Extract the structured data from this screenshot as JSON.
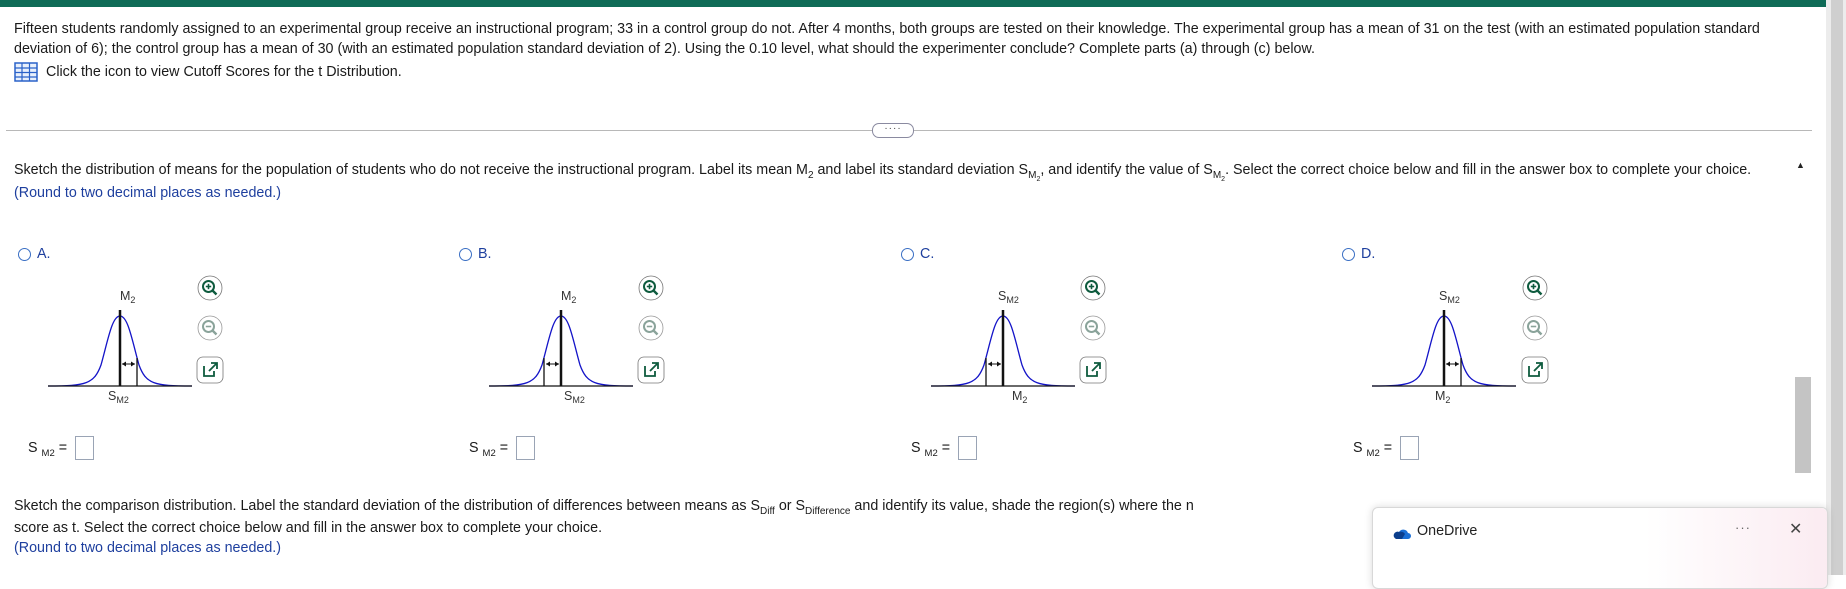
{
  "problem": {
    "text": "Fifteen students randomly assigned to an experimental group receive an instructional program; 33 in a control group do not. After 4 months, both groups are tested on their knowledge. The experimental group has a mean of 31 on the test (with an estimated population standard deviation of 6); the control group has a mean of 30 (with an estimated population standard deviation of 2). Using the 0.10 level, what should the experimenter conclude? Complete parts (a) through (c) below.",
    "cutoff_link": "Click the icon to view Cutoff Scores for the t Distribution."
  },
  "more_button": "····",
  "question": {
    "part1": "Sketch the distribution of means for the population of students who do not receive the instructional program. Label its mean M",
    "part2": " and label its standard deviation S",
    "part3": ", and identify the value of S",
    "part4": ". Select the correct choice below and fill in the answer box to complete your choice.",
    "sub_2": "2",
    "sub_M2": "M",
    "round_note": "(Round to two decimal places as needed.)"
  },
  "choices": [
    {
      "letter": "A.",
      "top_label": "M",
      "bottom_label": "S",
      "top_sub": "2",
      "bottom_sub": "M2",
      "answer_label": "S",
      "answer_sub": "M2",
      "answer_eq": "="
    },
    {
      "letter": "B.",
      "top_label": "M",
      "bottom_label": "S",
      "top_sub": "2",
      "bottom_sub": "M2",
      "answer_label": "S",
      "answer_sub": "M2",
      "answer_eq": "="
    },
    {
      "letter": "C.",
      "top_label": "S",
      "bottom_label": "M",
      "top_sub": "M2",
      "bottom_sub": "2",
      "answer_label": "S",
      "answer_sub": "M2",
      "answer_eq": "="
    },
    {
      "letter": "D.",
      "top_label": "S",
      "bottom_label": "M",
      "top_sub": "M2",
      "bottom_sub": "2",
      "answer_label": "S",
      "answer_sub": "M2",
      "answer_eq": "="
    }
  ],
  "next_question": {
    "part1": "Sketch the comparison distribution. Label the standard deviation of the distribution of differences between means as S",
    "sub_diff": "Diff",
    "or": " or S",
    "sub_difference": "Difference",
    "part2": " and identify its value, shade the region(s) where the n",
    "line2": "score as t. Select the correct choice below and fill in the answer box to complete your choice.",
    "round_note": "(Round to two decimal places as needed.)"
  },
  "toast": {
    "title": "OneDrive",
    "more": "···",
    "close": "✕"
  },
  "colors": {
    "accent": "#0f6b57",
    "link_blue": "#1e3f9e",
    "curve_blue": "#1414c8"
  }
}
